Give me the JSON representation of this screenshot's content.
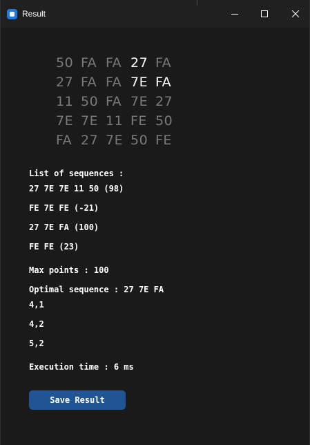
{
  "window": {
    "title": "Result"
  },
  "grid": [
    [
      {
        "text": "50",
        "highlight": false
      },
      {
        "text": "FA",
        "highlight": false
      },
      {
        "text": "FA",
        "highlight": false
      },
      {
        "text": "27",
        "highlight": true
      },
      {
        "text": "FA",
        "highlight": false
      }
    ],
    [
      {
        "text": "27",
        "highlight": false
      },
      {
        "text": "FA",
        "highlight": false
      },
      {
        "text": "FA",
        "highlight": false
      },
      {
        "text": "7E",
        "highlight": true
      },
      {
        "text": "FA",
        "highlight": true
      }
    ],
    [
      {
        "text": "11",
        "highlight": false
      },
      {
        "text": "50",
        "highlight": false
      },
      {
        "text": "FA",
        "highlight": false
      },
      {
        "text": "7E",
        "highlight": false
      },
      {
        "text": "27",
        "highlight": false
      }
    ],
    [
      {
        "text": "7E",
        "highlight": false
      },
      {
        "text": "7E",
        "highlight": false
      },
      {
        "text": "11",
        "highlight": false
      },
      {
        "text": "FE",
        "highlight": false
      },
      {
        "text": "50",
        "highlight": false
      }
    ],
    [
      {
        "text": "FA",
        "highlight": false
      },
      {
        "text": "27",
        "highlight": false
      },
      {
        "text": "7E",
        "highlight": false
      },
      {
        "text": "50",
        "highlight": false
      },
      {
        "text": "FE",
        "highlight": false
      }
    ]
  ],
  "sequences": {
    "header": "List of sequences :",
    "items": [
      "27 7E 7E 11 50 (98)",
      "FE 7E FE (-21)",
      "27 7E FA (100)",
      "FE FE (23)"
    ]
  },
  "max_points": "Max points : 100",
  "optimal": {
    "label": "Optimal sequence : 27 7E FA",
    "coords": [
      "4,1",
      "4,2",
      "5,2"
    ]
  },
  "execution_time": "Execution time : 6 ms",
  "save_button": "Save Result",
  "colors": {
    "background": "#1a1a1a",
    "titlebar": "#202020",
    "cell_normal": "#7a7a7a",
    "cell_highlight": "#ffffff",
    "button": "#1f5592"
  }
}
